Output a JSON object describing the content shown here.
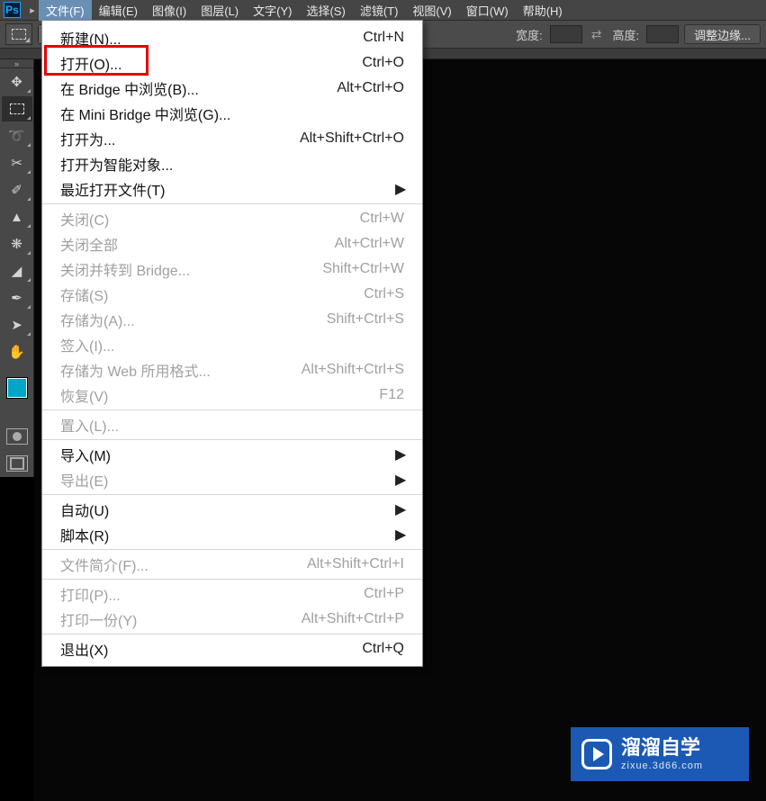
{
  "app": {
    "logo_text": "Ps"
  },
  "menubar": {
    "items": [
      {
        "label": "文件(F)",
        "active": true
      },
      {
        "label": "编辑(E)"
      },
      {
        "label": "图像(I)"
      },
      {
        "label": "图层(L)"
      },
      {
        "label": "文字(Y)"
      },
      {
        "label": "选择(S)"
      },
      {
        "label": "滤镜(T)"
      },
      {
        "label": "视图(V)"
      },
      {
        "label": "窗口(W)"
      },
      {
        "label": "帮助(H)"
      }
    ]
  },
  "optionsbar": {
    "width_label": "宽度:",
    "height_label": "高度:",
    "refine_label": "调整边缘..."
  },
  "dropdown": {
    "groups": [
      [
        {
          "label": "新建(N)...",
          "shortcut": "Ctrl+N"
        },
        {
          "label": "打开(O)...",
          "shortcut": "Ctrl+O"
        },
        {
          "label": "在 Bridge 中浏览(B)...",
          "shortcut": "Alt+Ctrl+O"
        },
        {
          "label": "在 Mini Bridge 中浏览(G)..."
        },
        {
          "label": "打开为...",
          "shortcut": "Alt+Shift+Ctrl+O"
        },
        {
          "label": "打开为智能对象..."
        },
        {
          "label": "最近打开文件(T)",
          "submenu": true
        }
      ],
      [
        {
          "label": "关闭(C)",
          "shortcut": "Ctrl+W",
          "disabled": true
        },
        {
          "label": "关闭全部",
          "shortcut": "Alt+Ctrl+W",
          "disabled": true
        },
        {
          "label": "关闭并转到 Bridge...",
          "shortcut": "Shift+Ctrl+W",
          "disabled": true
        },
        {
          "label": "存储(S)",
          "shortcut": "Ctrl+S",
          "disabled": true
        },
        {
          "label": "存储为(A)...",
          "shortcut": "Shift+Ctrl+S",
          "disabled": true
        },
        {
          "label": "签入(I)...",
          "disabled": true
        },
        {
          "label": "存储为 Web 所用格式...",
          "shortcut": "Alt+Shift+Ctrl+S",
          "disabled": true
        },
        {
          "label": "恢复(V)",
          "shortcut": "F12",
          "disabled": true
        }
      ],
      [
        {
          "label": "置入(L)...",
          "disabled": true
        }
      ],
      [
        {
          "label": "导入(M)",
          "submenu": true
        },
        {
          "label": "导出(E)",
          "submenu": true,
          "disabled": true
        }
      ],
      [
        {
          "label": "自动(U)",
          "submenu": true
        },
        {
          "label": "脚本(R)",
          "submenu": true
        }
      ],
      [
        {
          "label": "文件简介(F)...",
          "shortcut": "Alt+Shift+Ctrl+I",
          "disabled": true
        }
      ],
      [
        {
          "label": "打印(P)...",
          "shortcut": "Ctrl+P",
          "disabled": true
        },
        {
          "label": "打印一份(Y)",
          "shortcut": "Alt+Shift+Ctrl+P",
          "disabled": true
        }
      ],
      [
        {
          "label": "退出(X)",
          "shortcut": "Ctrl+Q"
        }
      ]
    ]
  },
  "tools": [
    {
      "name": "move-tool",
      "glyph": "✥"
    },
    {
      "name": "marquee-tool",
      "glyph": "▭",
      "selected": true
    },
    {
      "name": "lasso-tool",
      "glyph": "⌇"
    },
    {
      "name": "crop-tool",
      "glyph": "⌗"
    },
    {
      "name": "eyedropper-tool",
      "glyph": "✎"
    },
    {
      "name": "brush-tool",
      "glyph": "▲"
    },
    {
      "name": "stamp-tool",
      "glyph": "❋"
    },
    {
      "name": "eraser-tool",
      "glyph": "◢"
    },
    {
      "name": "pen-tool",
      "glyph": "✒"
    },
    {
      "name": "path-select-tool",
      "glyph": "⬀"
    },
    {
      "name": "hand-tool",
      "glyph": "✋"
    }
  ],
  "watermark": {
    "cn": "溜溜自学",
    "en": "zixue.3d66.com"
  }
}
